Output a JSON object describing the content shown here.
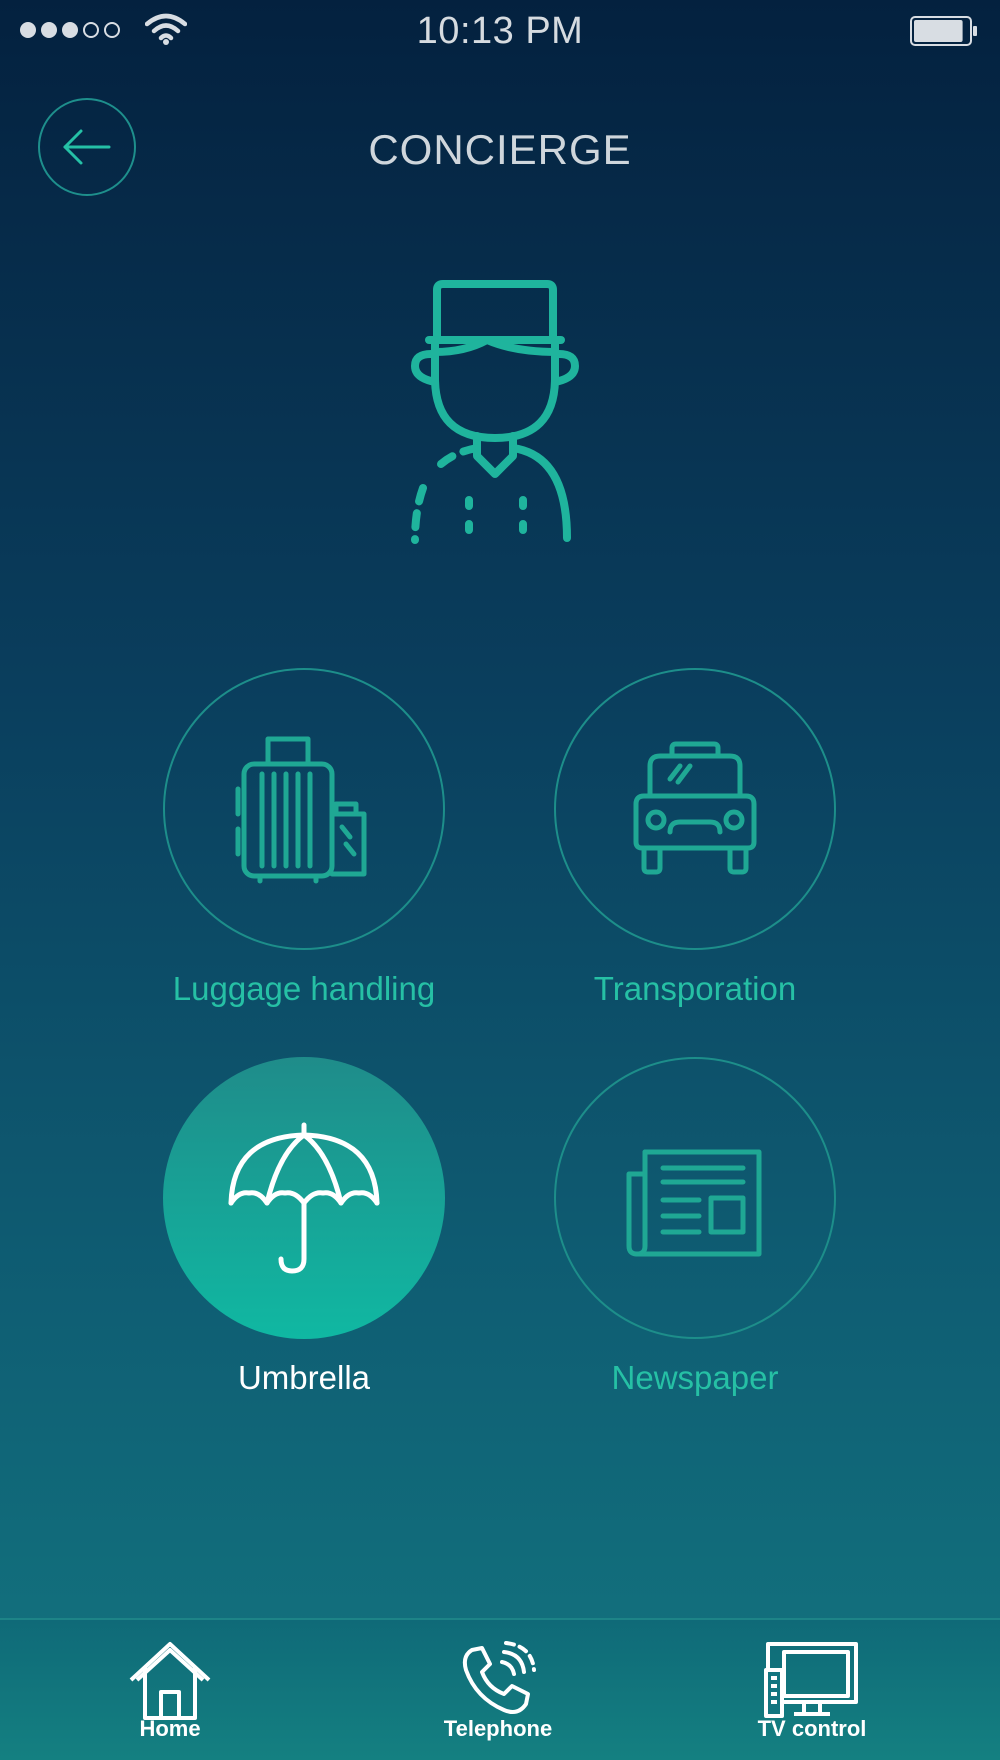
{
  "status_bar": {
    "time": "10:13 PM",
    "signal_bars_filled": 3,
    "signal_bars_total": 5,
    "battery_level": 0.9
  },
  "header": {
    "title": "CONCIERGE",
    "back_icon": "arrow-left-icon"
  },
  "hero": {
    "icon": "bellboy-icon"
  },
  "services": [
    {
      "label": "Luggage handling",
      "icon": "luggage-icon",
      "selected": false
    },
    {
      "label": "Transporation",
      "icon": "car-icon",
      "selected": false
    },
    {
      "label": "Umbrella",
      "icon": "umbrella-icon",
      "selected": true
    },
    {
      "label": "Newspaper",
      "icon": "newspaper-icon",
      "selected": false
    }
  ],
  "tab_bar": {
    "items": [
      {
        "label": "Home",
        "icon": "home-icon"
      },
      {
        "label": "Telephone",
        "icon": "phone-icon"
      },
      {
        "label": "TV control",
        "icon": "tv-icon"
      }
    ]
  },
  "colors": {
    "accent": "#1fb8a0",
    "accent_dark": "#1d8e8a",
    "background_top": "#04213f",
    "background_bottom": "#137680",
    "title_text": "#cfd6dc",
    "selected_text": "#ffffff"
  }
}
